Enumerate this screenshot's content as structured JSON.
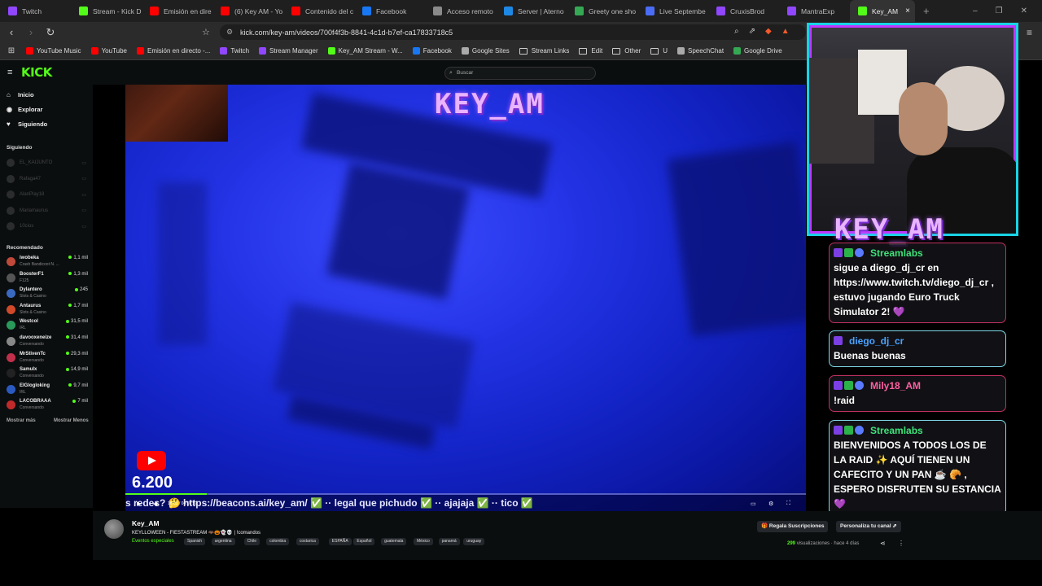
{
  "tabs": [
    {
      "label": "Twitch",
      "color": "#9147ff"
    },
    {
      "label": "Stream - Kick D",
      "color": "#53fc18"
    },
    {
      "label": "Emisión en dire",
      "color": "#ff0000"
    },
    {
      "label": "(6) Key AM - Yo",
      "color": "#ff0000"
    },
    {
      "label": "Contenido del c",
      "color": "#ff0000"
    },
    {
      "label": "Facebook",
      "color": "#1877f2"
    },
    {
      "label": "Acceso remoto",
      "color": "#8a8a8a"
    },
    {
      "label": "Server | Aterno",
      "color": "#1e88e5"
    },
    {
      "label": "Greety one sho",
      "color": "#34a853"
    },
    {
      "label": "Live Septembe",
      "color": "#4a6cf7"
    },
    {
      "label": "CruxisBrod",
      "color": "#9147ff"
    },
    {
      "label": "MantraExp",
      "color": "#9147ff"
    },
    {
      "label": "Key_AM",
      "color": "#53fc18",
      "active": true
    }
  ],
  "url": "kick.com/key-am/videos/700f4f3b-8841-4c1d-b7ef-ca17833718c5",
  "bookmarks": [
    {
      "label": "YouTube Music",
      "color": "#ff0000"
    },
    {
      "label": "YouTube",
      "color": "#ff0000"
    },
    {
      "label": "Emisión en directo -...",
      "color": "#ff0000"
    },
    {
      "label": "Twitch",
      "color": "#9147ff"
    },
    {
      "label": "Stream Manager",
      "color": "#9147ff"
    },
    {
      "label": "Key_AM Stream - W...",
      "color": "#53fc18"
    },
    {
      "label": "Facebook",
      "color": "#1877f2"
    },
    {
      "label": "Google Sites",
      "color": "#aaaaaa"
    },
    {
      "label": "Stream Links",
      "folder": true
    },
    {
      "label": "Edit",
      "folder": true
    },
    {
      "label": "Other",
      "folder": true
    },
    {
      "label": "U",
      "folder": true
    },
    {
      "label": "SpeechChat",
      "color": "#aaaaaa"
    },
    {
      "label": "Google Drive",
      "color": "#34a853"
    }
  ],
  "kick": {
    "logo": "KICK",
    "search_placeholder": "Buscar",
    "nav": [
      {
        "label": "Inicio",
        "icon": "⌂"
      },
      {
        "label": "Explorar",
        "icon": "◉"
      },
      {
        "label": "Siguiendo",
        "icon": "♥"
      }
    ],
    "following_header": "Siguiendo",
    "following": [
      "EL_KAIJUNTO",
      "Rafaga47",
      "AlanPlay18",
      "Mariamaurus",
      "10cios"
    ],
    "recommended_header": "Recomendado",
    "recommended": [
      {
        "name": "iwobeka",
        "cat": "Crash Bandicoot N. ...",
        "views": "1,1 mil",
        "color": "#c04a3a"
      },
      {
        "name": "BoosterF1",
        "cat": "F125",
        "views": "1,3 mil",
        "color": "#555"
      },
      {
        "name": "Dylantero",
        "cat": "Slots & Casino",
        "views": "245",
        "color": "#3a6ac0"
      },
      {
        "name": "Antaurus",
        "cat": "Slots & Casino",
        "views": "1,7 mil",
        "color": "#d04a2a"
      },
      {
        "name": "Westcol",
        "cat": "IRL",
        "views": "31,5 mil",
        "color": "#2a9a5a"
      },
      {
        "name": "davooxeneize",
        "cat": "Conversando",
        "views": "31,4 mil",
        "color": "#888"
      },
      {
        "name": "MrStivenTc",
        "cat": "Conversando",
        "views": "29,3 mil",
        "color": "#c0304a"
      },
      {
        "name": "Samulx",
        "cat": "Conversando",
        "views": "14,9 mil",
        "color": "#222"
      },
      {
        "name": "ElGlogloking",
        "cat": "IRL",
        "views": "9,7 mil",
        "color": "#2a5ac0"
      },
      {
        "name": "LACOBRAAA",
        "cat": "Conversando",
        "views": "7 mil",
        "color": "#c02a2a"
      }
    ],
    "show_more": "Mostrar más",
    "show_less": "Mostrar Menos"
  },
  "video": {
    "overlay_title": "KEY_AM",
    "subscriber_count": "6.200",
    "ticker": "s redes? 🤔 https://beacons.ai/key_am/ ✅ ·· legal que pichudo ✅ ·· ajajaja ✅ ·· tico ✅",
    "time": "18:61 / 04:16:59",
    "progress": 0.12
  },
  "webcam": {
    "name": "KEY_AM"
  },
  "chat": [
    {
      "user": "Streamlabs",
      "user_color": "#3ee37a",
      "text": "sigue a diego_dj_cr en https://www.twitch.tv/diego_dj_cr , estuvo jugando Euro Truck Simulator 2! 💜",
      "border": "#c03060"
    },
    {
      "user": "diego_dj_cr",
      "user_color": "#4aa3ff",
      "text": "Buenas buenas",
      "border": "#7fd7e6"
    },
    {
      "user": "Mily18_AM",
      "user_color": "#ff5fa2",
      "text": "!raid",
      "border": "#c03060"
    },
    {
      "user": "Streamlabs",
      "user_color": "#3ee37a",
      "text": "BIENVENIDOS A TODOS LOS DE LA RAID ✨ AQUÍ TIENEN UN CAFECITO Y UN PAN ☕ 🥐 , ESPERO DISFRUTEN SU ESTANCIA 💜",
      "border": "#7fd7e6"
    }
  ],
  "channel": {
    "name": "Key_AM",
    "title": "KEYLLOWEEN - FIESTASTREAM 🦇🎃👻💀 | !comandos",
    "category": "Eventos especiales",
    "tags": [
      "Spanish",
      "argentina",
      "Chile",
      "colombia",
      "costarica",
      "ESPAÑA",
      "Español",
      "guatemala",
      "México",
      "panamá",
      "uruguay"
    ],
    "views_count": "299",
    "views_label": "visualizaciones",
    "ago": "hace 4 días",
    "gift_subs": "Regala Suscripciones",
    "customize": "Personaliza tu canal"
  }
}
